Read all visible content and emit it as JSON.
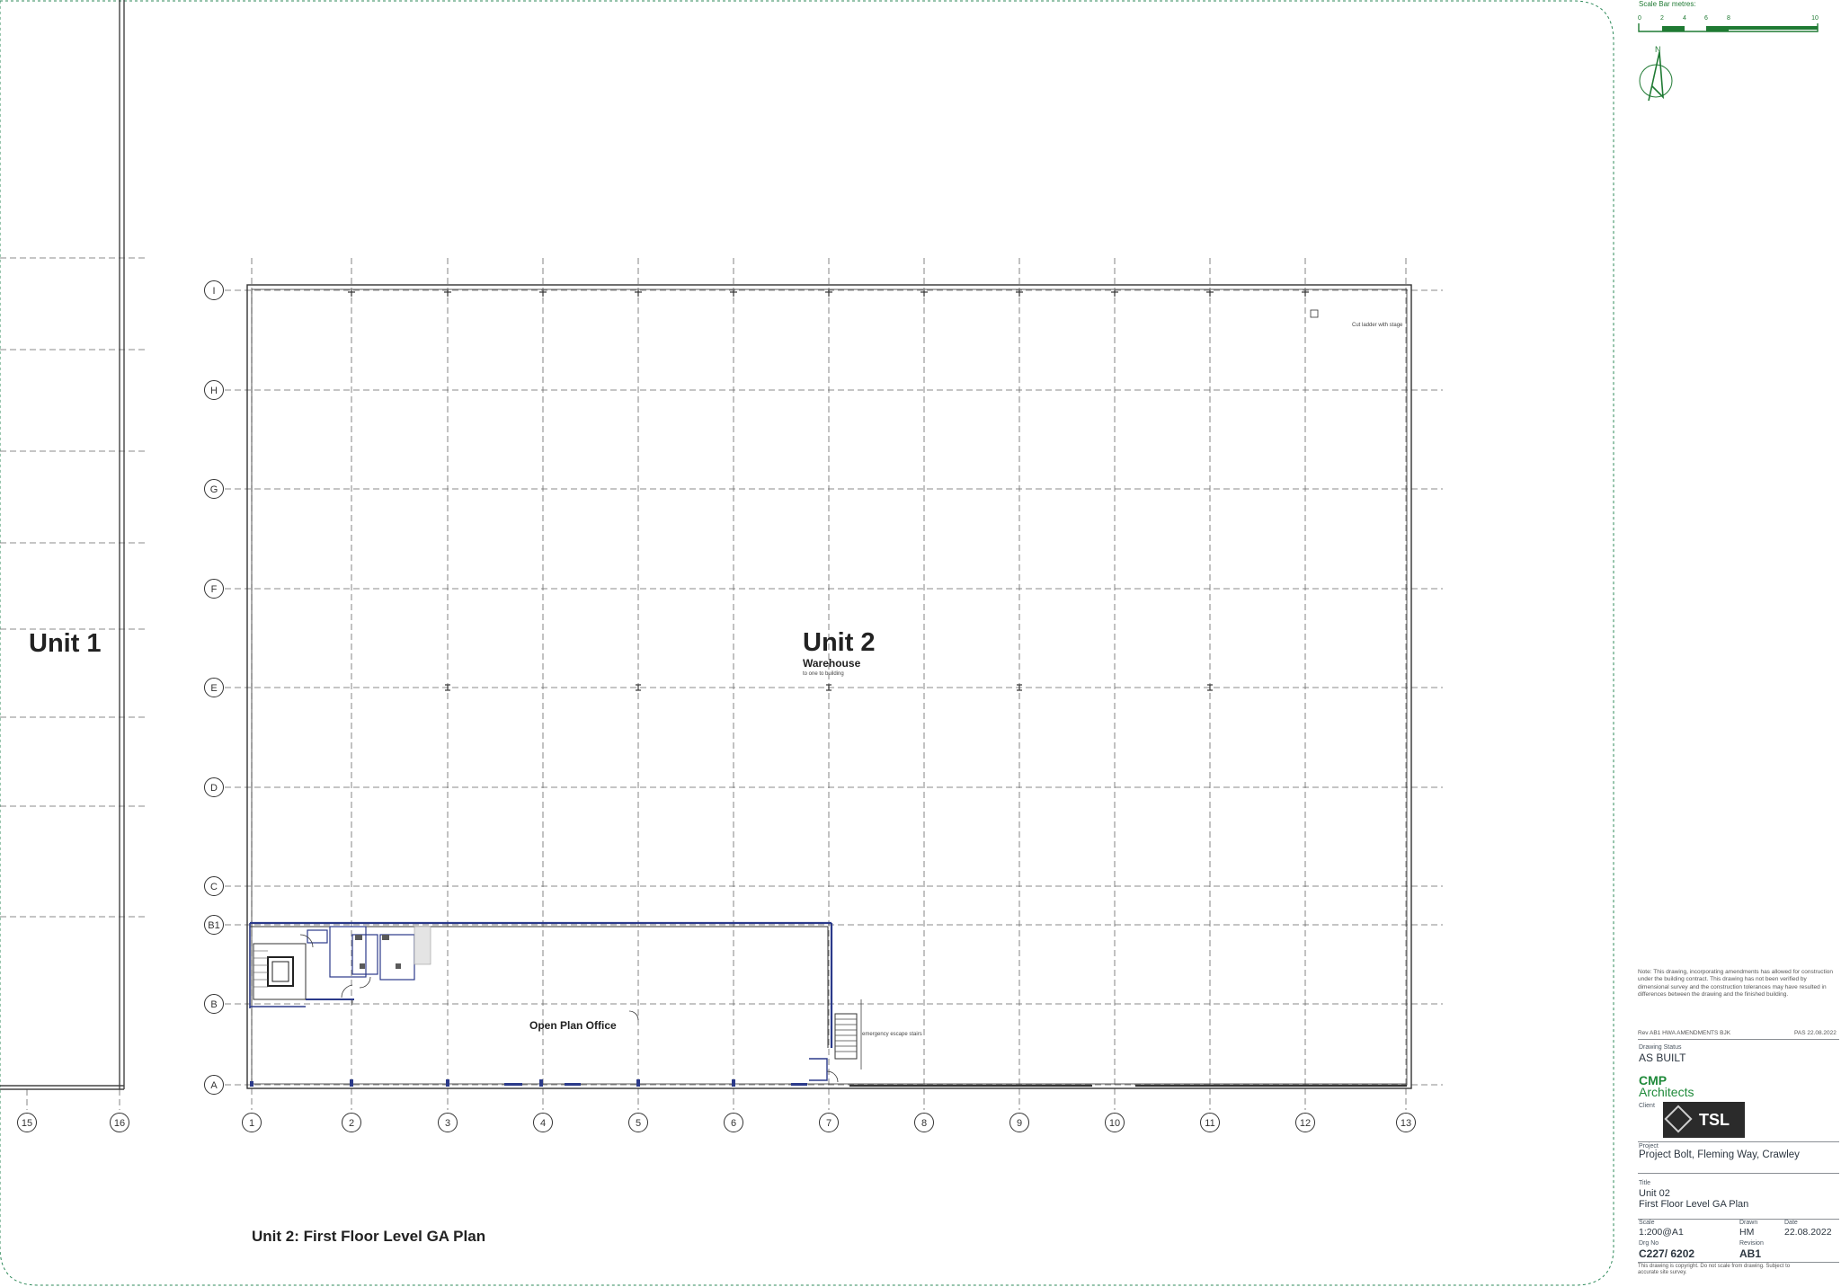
{
  "drawing": {
    "unit_left": "Unit 1",
    "unit_main": "Unit 2",
    "room_warehouse": "Warehouse",
    "room_warehouse_sub": "to one to building",
    "room_office": "Open Plan Office",
    "escape_stairs": "emergency escape stairs",
    "note_top_right": "Cut ladder with stage",
    "plan_title": "Unit 2:  First Floor Level GA Plan",
    "grid_rows": [
      "I",
      "H",
      "G",
      "F",
      "E",
      "D",
      "C",
      "B1",
      "B",
      "A"
    ],
    "grid_cols": [
      "1",
      "2",
      "3",
      "4",
      "5",
      "6",
      "7",
      "8",
      "9",
      "10",
      "11",
      "12",
      "13"
    ],
    "grid_cols_left": [
      "15",
      "16"
    ]
  },
  "scale_bar": {
    "label": "Scale Bar    metres:",
    "ticks": [
      "0",
      "2",
      "4",
      "6",
      "8",
      "10"
    ],
    "color": "#1f7a33"
  },
  "north_arrow": {
    "label": "N"
  },
  "title_block": {
    "note": "Note: This drawing, incorporating amendments has allowed for construction under the building contract. This drawing has not been verified by dimensional survey and the construction tolerances may have resulted in differences between the drawing and the finished building.",
    "rev_line_left": "Rev AB1  HWA  AMENDMENTS  BJK",
    "rev_line_right": "PAS  22.08.2022",
    "status_label": "Drawing Status",
    "status_value": "AS BUILT",
    "firm_name": "CMP",
    "firm_sub": "Architects",
    "client_label": "Client",
    "client_logo": "TSL",
    "project_label": "Project",
    "project_value": "Project Bolt, Fleming Way, Crawley",
    "title_label": "Title",
    "title_line1": "Unit 02",
    "title_line2": "First Floor Level GA Plan",
    "scale_label": "Scale",
    "scale_value": "1:200@A1",
    "drawn_label": "Drawn",
    "drawn_value": "HM",
    "date_label": "Date",
    "date_value": "22.08.2022",
    "drawing_no_label": "Drg No",
    "drawing_no_value": "C227/ 6202",
    "revision_label": "Revision",
    "revision_value": "AB1",
    "copyright": "This drawing is copyright. Do not scale from drawing. Subject to accurate site survey.",
    "green": "#1f8a3a"
  }
}
